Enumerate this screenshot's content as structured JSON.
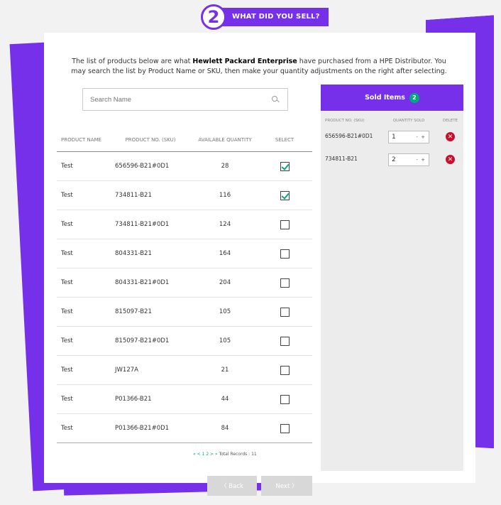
{
  "step": {
    "number": "2",
    "label": "WHAT DID YOU SELL?"
  },
  "intro": {
    "prefix": "The list of products below are what ",
    "company": "Hewlett Packard Enterprise",
    "suffix": " have purchased from a HPE Distributor. You may search the list by Product Name or SKU, then make your quantity adjustments on the right after selecting."
  },
  "search": {
    "placeholder": "Search Name",
    "icon": "search-icon"
  },
  "table": {
    "headers": {
      "name": "PRODUCT NAME",
      "sku": "PRODUCT NO. (SKU)",
      "qty": "AVAILABLE QUANTITY",
      "select": "SELECT"
    },
    "rows": [
      {
        "name": "Test",
        "sku": "656596-B21#0D1",
        "qty": "28",
        "selected": true
      },
      {
        "name": "Test",
        "sku": "734811-B21",
        "qty": "116",
        "selected": true
      },
      {
        "name": "Test",
        "sku": "734811-B21#0D1",
        "qty": "124",
        "selected": false
      },
      {
        "name": "Test",
        "sku": "804331-B21",
        "qty": "164",
        "selected": false
      },
      {
        "name": "Test",
        "sku": "804331-B21#0D1",
        "qty": "204",
        "selected": false
      },
      {
        "name": "Test",
        "sku": "815097-B21",
        "qty": "105",
        "selected": false
      },
      {
        "name": "Test",
        "sku": "815097-B21#0D1",
        "qty": "105",
        "selected": false
      },
      {
        "name": "Test",
        "sku": "JW127A",
        "qty": "21",
        "selected": false
      },
      {
        "name": "Test",
        "sku": "P01366-B21",
        "qty": "44",
        "selected": false
      },
      {
        "name": "Test",
        "sku": "P01366-B21#0D1",
        "qty": "84",
        "selected": false
      }
    ]
  },
  "pager": {
    "nav": "« < 1 2 > »",
    "total": "Total Records : 11"
  },
  "sold": {
    "title": "Sold Items",
    "count": "2",
    "headers": {
      "sku": "PRODUCT NO. (SKU)",
      "qty": "QUANTITY SOLD",
      "del": "DELETE"
    },
    "items": [
      {
        "sku": "656596-B21#0D1",
        "qty": "1",
        "controls": "- +"
      },
      {
        "sku": "734811-B21",
        "qty": "2",
        "controls": "- +"
      }
    ]
  },
  "buttons": {
    "back": "〈  Back",
    "next": "Next  〉"
  },
  "colors": {
    "brand": "#7630ea",
    "accent": "#01a982",
    "delete": "#c8102e"
  }
}
